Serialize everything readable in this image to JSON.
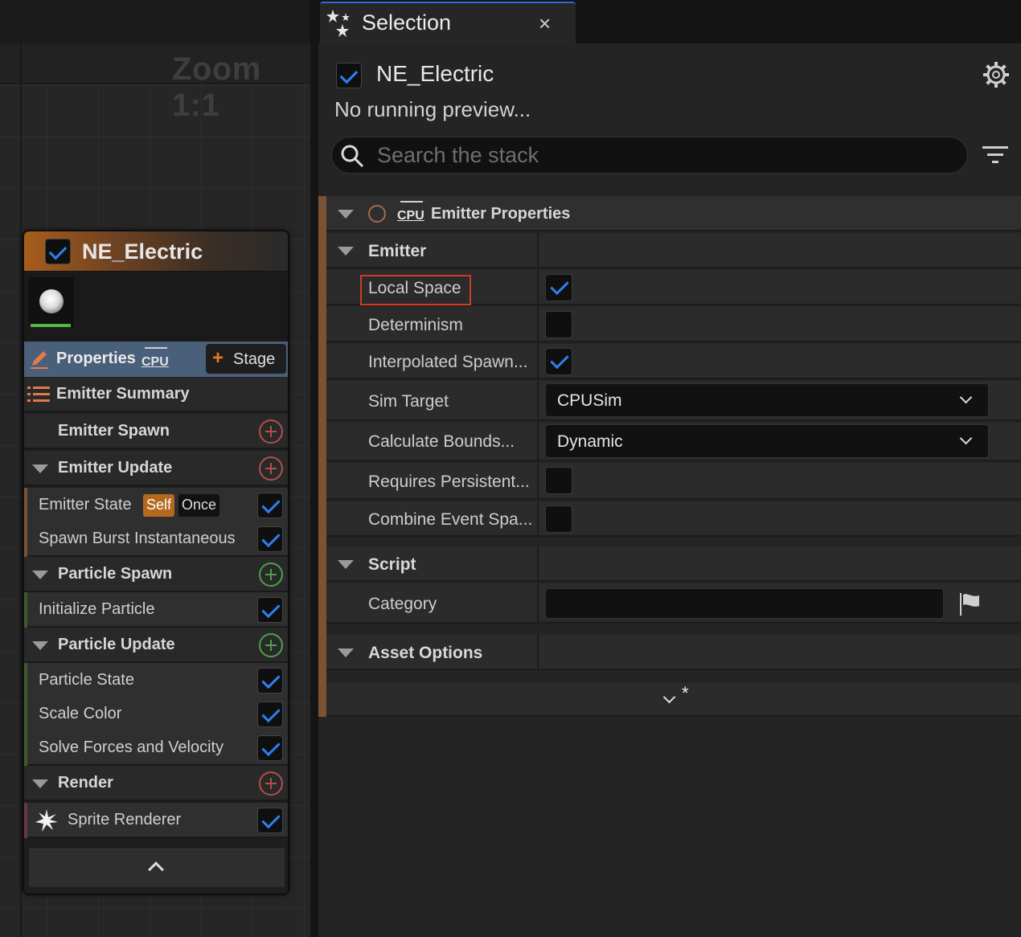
{
  "graph": {
    "zoom_label": "Zoom 1:1",
    "node": {
      "title": "NE_Electric",
      "properties_label": "Properties",
      "cpu_label": "CPU",
      "stage_label": "Stage",
      "summary_label": "Emitter Summary",
      "groups": [
        {
          "label": "Emitter Spawn"
        },
        {
          "label": "Emitter Update"
        },
        {
          "label": "Particle Spawn"
        },
        {
          "label": "Particle Update"
        },
        {
          "label": "Render"
        }
      ],
      "modules": {
        "emitter_state": "Emitter State",
        "badge_self": "Self",
        "badge_once": "Once",
        "spawn_burst": "Spawn Burst Instantaneous",
        "initialize_particle": "Initialize Particle",
        "particle_state": "Particle State",
        "scale_color": "Scale Color",
        "solve_forces": "Solve Forces and Velocity",
        "sprite_renderer": "Sprite Renderer"
      }
    }
  },
  "tab": {
    "title": "Selection",
    "close": "×"
  },
  "panel": {
    "emitter_name": "NE_Electric",
    "preview_text": "No running preview...",
    "search_placeholder": "Search the stack",
    "section_title": "Emitter Properties",
    "section_cpu": "CPU",
    "emitter_group": "Emitter",
    "properties": [
      {
        "label": "Local Space",
        "type": "checkbox",
        "checked": true
      },
      {
        "label": "Determinism",
        "type": "checkbox",
        "checked": false
      },
      {
        "label": "Interpolated Spawn...",
        "type": "checkbox",
        "checked": true
      },
      {
        "label": "Sim Target",
        "type": "combo",
        "value": "CPUSim"
      },
      {
        "label": "Calculate Bounds...",
        "type": "combo",
        "value": "Dynamic"
      },
      {
        "label": "Requires Persistent...",
        "type": "checkbox",
        "checked": false
      },
      {
        "label": "Combine Event Spa...",
        "type": "checkbox",
        "checked": false
      }
    ],
    "script_group": "Script",
    "category_label": "Category",
    "category_value": "",
    "asset_options": "Asset Options",
    "more_marker": "*"
  },
  "colors": {
    "accent_blue": "#2d80f3",
    "emitter_orange": "#b36a1e",
    "highlight_red": "#d03a22",
    "add_red": "#b0504a",
    "add_green": "#4ca148"
  }
}
